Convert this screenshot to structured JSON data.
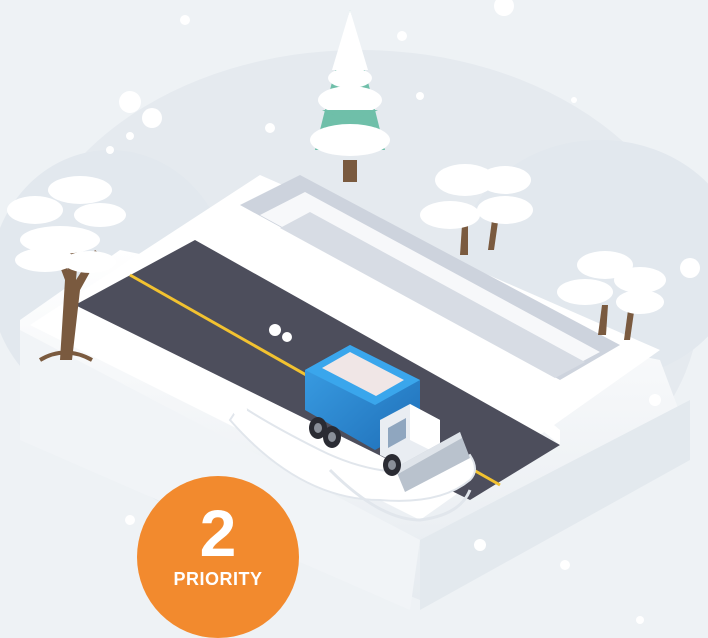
{
  "badge": {
    "number": "2",
    "label": "PRIORITY",
    "color": "#f28a2e"
  },
  "colors": {
    "background": "#eef2f5",
    "snow": "#ffffff",
    "road": "#4d4e5c",
    "road_centerline": "#f2c230",
    "truck_body": "#2f8fd8",
    "truck_cab": "#e9edf2",
    "pine": "#6fbfa9",
    "trunk": "#7a5a3f"
  },
  "icons": [
    "snowplow-truck-icon",
    "pine-tree-icon",
    "bare-tree-icon",
    "snowflake-icon"
  ]
}
